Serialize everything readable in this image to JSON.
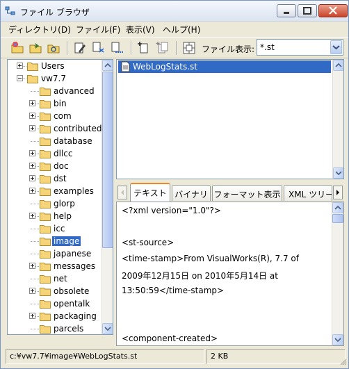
{
  "window": {
    "title": "ファイル ブラウザ"
  },
  "menu": [
    {
      "label": "ディレクトリ(D)"
    },
    {
      "label": "ファイル(F)"
    },
    {
      "label": "表示(V)"
    },
    {
      "label": "ヘルプ(H)"
    }
  ],
  "toolbar": {
    "filter_label": "ファイル表示:",
    "filter_value": "*.st",
    "buttons": [
      "new-folder-icon",
      "open-folder-icon",
      "refresh-icon",
      "edit-icon",
      "file-in-icon",
      "file-out-icon",
      "add-icon",
      "add-all-icon",
      "settings-icon"
    ]
  },
  "tree": [
    {
      "label": "Users",
      "level": 1,
      "expander": "plus"
    },
    {
      "label": "vw7.7",
      "level": 1,
      "expander": "minus"
    },
    {
      "label": "advanced",
      "level": 2,
      "expander": "none"
    },
    {
      "label": "bin",
      "level": 2,
      "expander": "plus"
    },
    {
      "label": "com",
      "level": 2,
      "expander": "plus"
    },
    {
      "label": "contributed",
      "level": 2,
      "expander": "plus"
    },
    {
      "label": "database",
      "level": 2,
      "expander": "none"
    },
    {
      "label": "dllcc",
      "level": 2,
      "expander": "plus"
    },
    {
      "label": "doc",
      "level": 2,
      "expander": "plus"
    },
    {
      "label": "dst",
      "level": 2,
      "expander": "plus"
    },
    {
      "label": "examples",
      "level": 2,
      "expander": "plus"
    },
    {
      "label": "glorp",
      "level": 2,
      "expander": "none"
    },
    {
      "label": "help",
      "level": 2,
      "expander": "plus"
    },
    {
      "label": "icc",
      "level": 2,
      "expander": "none"
    },
    {
      "label": "image",
      "level": 2,
      "expander": "none",
      "selected": true
    },
    {
      "label": "japanese",
      "level": 2,
      "expander": "none"
    },
    {
      "label": "messages",
      "level": 2,
      "expander": "plus"
    },
    {
      "label": "net",
      "level": 2,
      "expander": "none"
    },
    {
      "label": "obsolete",
      "level": 2,
      "expander": "plus"
    },
    {
      "label": "opentalk",
      "level": 2,
      "expander": "none"
    },
    {
      "label": "packaging",
      "level": 2,
      "expander": "plus"
    },
    {
      "label": "parcels",
      "level": 2,
      "expander": "none"
    }
  ],
  "files": [
    {
      "name": "WebLogStats.st",
      "selected": true
    }
  ],
  "tabs": [
    {
      "label": "テキスト",
      "active": true
    },
    {
      "label": "バイナリ",
      "active": false
    },
    {
      "label": "フォーマット表示",
      "active": false
    },
    {
      "label": "XML ツリー",
      "active": false
    }
  ],
  "content_lines": [
    "<?xml version=\"1.0\"?>",
    "",
    "<st-source>",
    "<time-stamp>From VisualWorks(R), 7.7 of",
    "2009年12月15日 on 2010年5月14日 at",
    "13:50:59</time-stamp>",
    "",
    "",
    "<component-created>"
  ],
  "status": {
    "path": "c:¥vw7.7¥image¥WebLogStats.st",
    "size": "2 KB"
  },
  "colors": {
    "selection": "#316ac5",
    "window_bg": "#ece9d8",
    "active_tab_accent": "#e68b2c"
  }
}
